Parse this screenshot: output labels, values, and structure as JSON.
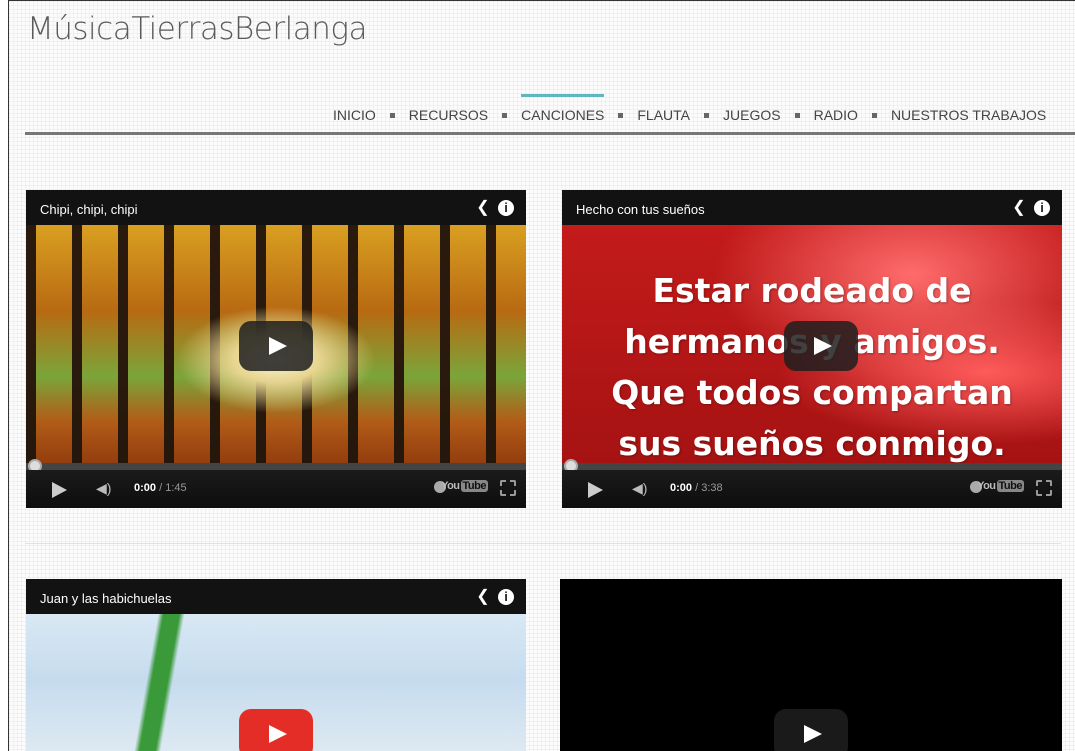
{
  "site": {
    "title": "MúsicaTierrasBerlanga"
  },
  "nav": {
    "items": [
      {
        "label": "INICIO"
      },
      {
        "label": "RECURSOS"
      },
      {
        "label": "CANCIONES",
        "active": true
      },
      {
        "label": "FLAUTA"
      },
      {
        "label": "JUEGOS"
      },
      {
        "label": "RADIO"
      },
      {
        "label": "NUESTROS TRABAJOS"
      }
    ],
    "accent_color": "#5fb6c0"
  },
  "videos": [
    {
      "title": "Chipi, chipi, chipi",
      "current_time": "0:00",
      "duration": "/ 1:45",
      "progress": 0
    },
    {
      "title": "Hecho con tus sueños",
      "current_time": "0:00",
      "duration": "/ 3:38",
      "progress": 0,
      "overlay_lines": [
        "Estar rodeado de",
        "hermanos y amigos.",
        "Que todos compartan",
        "sus sueños conmigo."
      ]
    },
    {
      "title": "Juan y las habichuelas"
    },
    {
      "title": ""
    }
  ],
  "player": {
    "brand_you": "You",
    "brand_tube": "Tube"
  },
  "icons": [
    "share-icon",
    "info-icon",
    "play-icon",
    "volume-icon",
    "clock-icon",
    "fullscreen-icon"
  ]
}
